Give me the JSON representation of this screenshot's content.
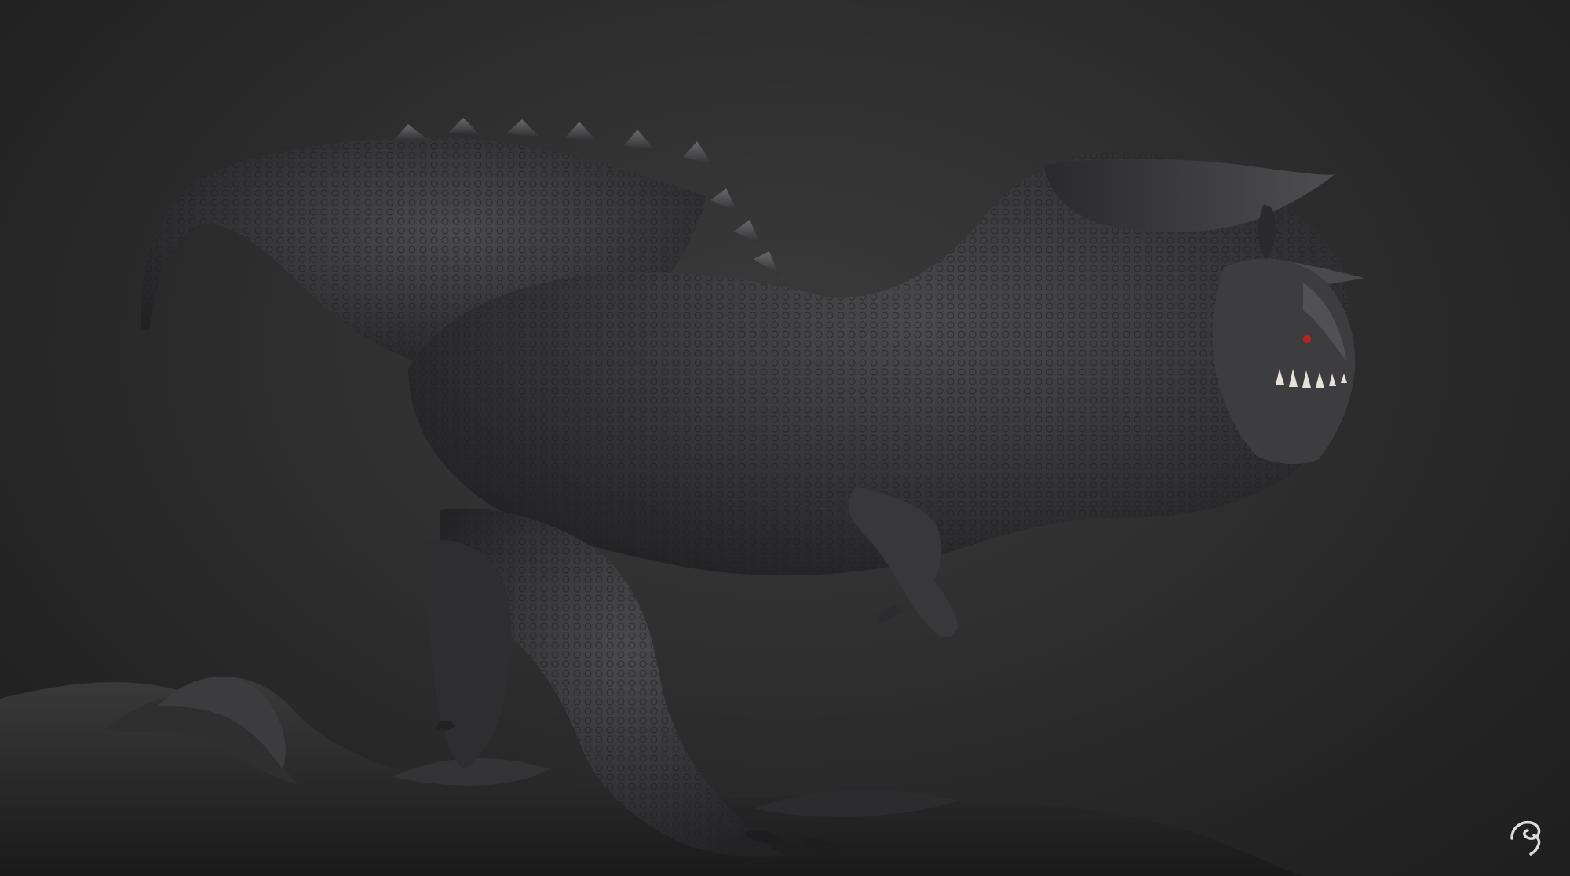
{
  "scene": {
    "subject": "sculpted-creature",
    "background_color": "#2e2e2e",
    "creature_color": "#3a3a3c",
    "eye_color": "#c0201c",
    "teeth_color": "#e6e2d8",
    "ground_color": "#2b2b2b"
  },
  "signature": {
    "icon": "artist-signature-logo",
    "color": "#dcdcdc"
  }
}
